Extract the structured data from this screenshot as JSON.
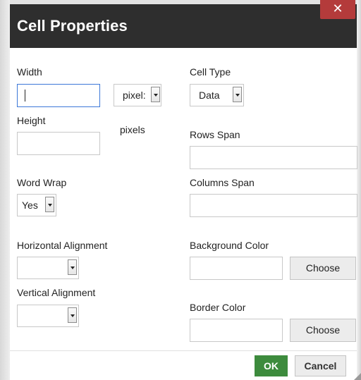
{
  "dialog": {
    "title": "Cell Properties",
    "close_glyph": "✕"
  },
  "left": {
    "width_label": "Width",
    "width_value": "",
    "width_unit": "pixel:",
    "height_label": "Height",
    "height_value": "",
    "height_unit_text": "pixels",
    "word_wrap_label": "Word Wrap",
    "word_wrap_value": "Yes",
    "h_align_label": "Horizontal Alignment",
    "h_align_value": "",
    "v_align_label": "Vertical Alignment",
    "v_align_value": ""
  },
  "right": {
    "cell_type_label": "Cell Type",
    "cell_type_value": "Data",
    "rows_span_label": "Rows Span",
    "rows_span_value": "",
    "columns_span_label": "Columns Span",
    "columns_span_value": "",
    "bg_color_label": "Background Color",
    "bg_color_value": "",
    "bg_choose_label": "Choose",
    "border_color_label": "Border Color",
    "border_color_value": "",
    "border_choose_label": "Choose"
  },
  "footer": {
    "ok_label": "OK",
    "cancel_label": "Cancel"
  },
  "colors": {
    "titlebar": "#2e2e2e",
    "close": "#b43b3b",
    "ok": "#3d8b3d",
    "focus": "#3c78d8"
  }
}
